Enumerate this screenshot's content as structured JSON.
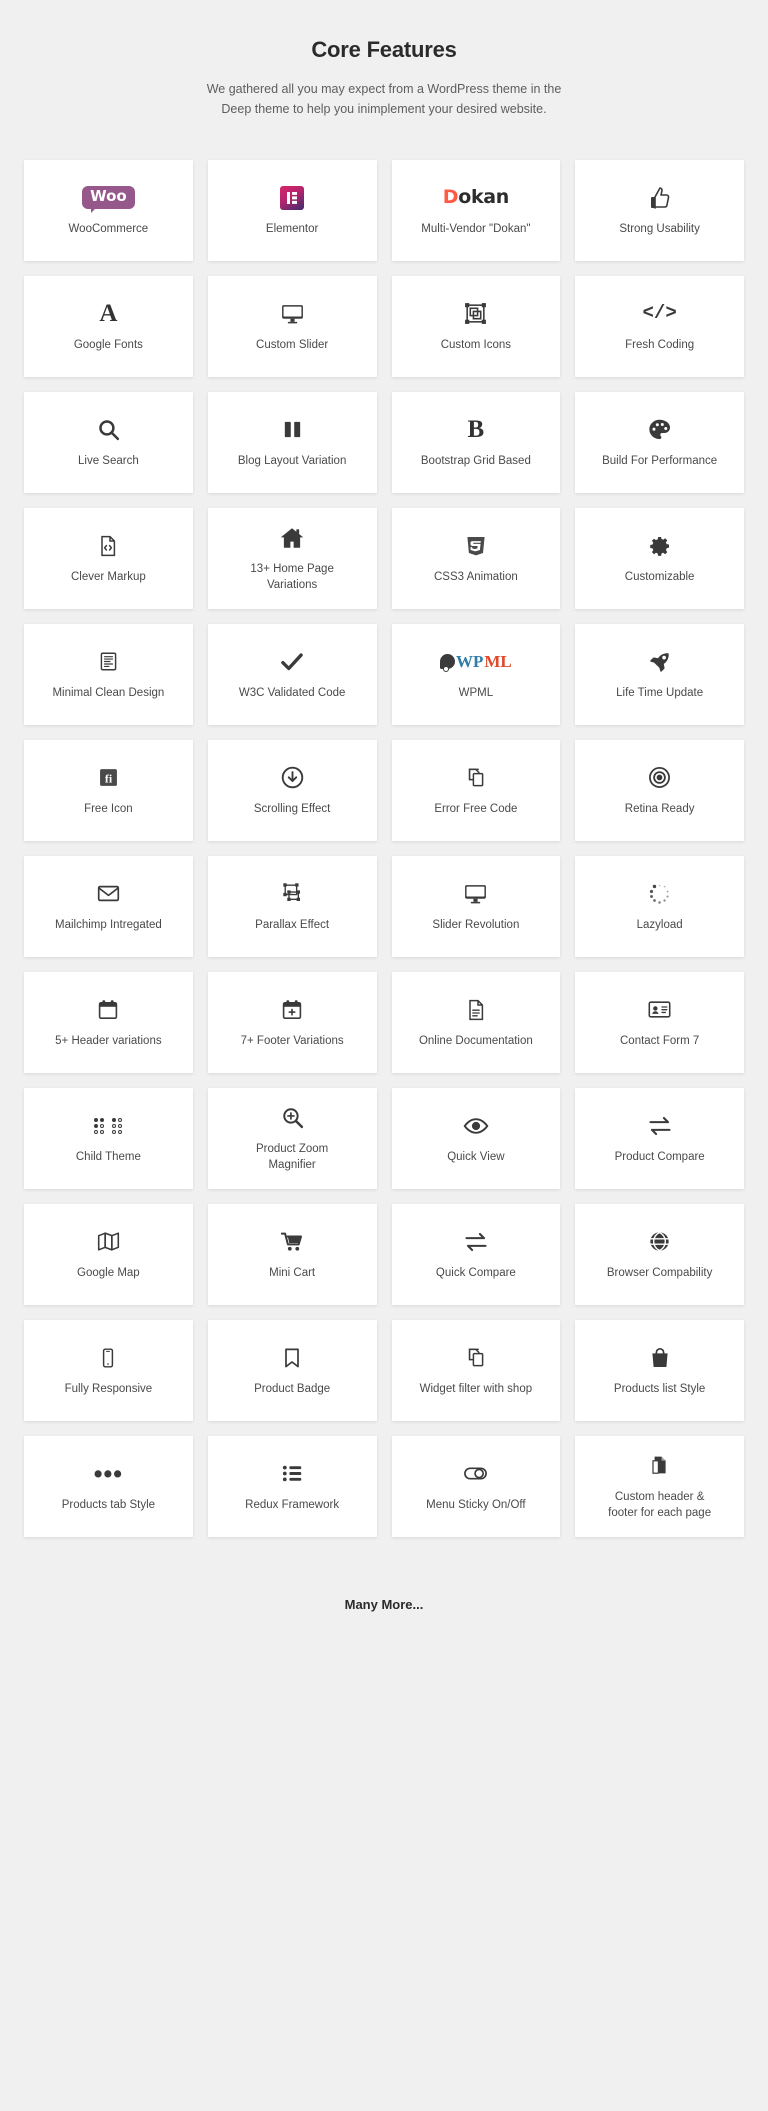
{
  "header": {
    "title": "Core Features",
    "subtitle": "We gathered all you may expect from a WordPress theme in the Deep theme to help you inimplement your desired website."
  },
  "brand_colors": {
    "woo_purple": "#96588a",
    "elementor_pink": "#d6266a",
    "elementor_indigo": "#3d2e6e",
    "dokan_orange": "#ff5a43",
    "wpml_blue": "#2f7da8",
    "wpml_red": "#e0482c",
    "card_bg": "#ffffff",
    "page_bg": "#f0f0f0",
    "icon_gray": "#3a3a3a",
    "label_gray": "#4a4a4a"
  },
  "features": [
    {
      "label": "WooCommerce",
      "icon": "woo-logo"
    },
    {
      "label": "Elementor",
      "icon": "elementor-logo"
    },
    {
      "label": "Multi-Vendor \"Dokan\"",
      "icon": "dokan-logo"
    },
    {
      "label": "Strong Usability",
      "icon": "thumbs-up-icon"
    },
    {
      "label": "Google Fonts",
      "icon": "letter-a-icon"
    },
    {
      "label": "Custom Slider",
      "icon": "monitor-icon"
    },
    {
      "label": "Custom Icons",
      "icon": "custom-icons-icon"
    },
    {
      "label": "Fresh Coding",
      "icon": "code-brackets-icon"
    },
    {
      "label": "Live Search",
      "icon": "magnifier-icon"
    },
    {
      "label": "Blog Layout Variation",
      "icon": "two-columns-icon"
    },
    {
      "label": "Bootstrap Grid Based",
      "icon": "letter-b-icon"
    },
    {
      "label": "Build For Performance",
      "icon": "palette-icon"
    },
    {
      "label": "Clever Markup",
      "icon": "file-code-icon"
    },
    {
      "label": "13+ Home Page Variations",
      "icon": "home-icon"
    },
    {
      "label": "CSS3 Animation",
      "icon": "css3-shield-icon"
    },
    {
      "label": "Customizable",
      "icon": "gear-icon"
    },
    {
      "label": "Minimal Clean Design",
      "icon": "clipboard-icon"
    },
    {
      "label": "W3C Validated Code",
      "icon": "check-icon"
    },
    {
      "label": "WPML",
      "icon": "wpml-logo"
    },
    {
      "label": "Life Time Update",
      "icon": "rocket-icon"
    },
    {
      "label": "Free Icon",
      "icon": "font-awesome-icon"
    },
    {
      "label": "Scrolling Effect",
      "icon": "arrow-down-circle-icon"
    },
    {
      "label": "Error Free Code",
      "icon": "copy-icon"
    },
    {
      "label": "Retina Ready",
      "icon": "target-icon"
    },
    {
      "label": "Mailchimp Intregated",
      "icon": "envelope-icon"
    },
    {
      "label": "Parallax Effect",
      "icon": "parallax-icon"
    },
    {
      "label": "Slider Revolution",
      "icon": "monitor-icon"
    },
    {
      "label": "Lazyload",
      "icon": "spinner-icon"
    },
    {
      "label": "5+ Header variations",
      "icon": "calendar-icon"
    },
    {
      "label": "7+ Footer Variations",
      "icon": "calendar-plus-icon"
    },
    {
      "label": "Online Documentation",
      "icon": "document-icon"
    },
    {
      "label": "Contact Form 7",
      "icon": "id-card-icon"
    },
    {
      "label": "Child Theme",
      "icon": "dot-matrix-icon"
    },
    {
      "label": "Product Zoom Magnifier",
      "icon": "magnifier-plus-icon"
    },
    {
      "label": "Quick View",
      "icon": "eye-icon"
    },
    {
      "label": "Product Compare",
      "icon": "exchange-arrows-icon"
    },
    {
      "label": "Google Map",
      "icon": "map-icon"
    },
    {
      "label": "Mini Cart",
      "icon": "cart-icon"
    },
    {
      "label": "Quick Compare",
      "icon": "exchange-arrows-icon"
    },
    {
      "label": "Browser Compability",
      "icon": "globe-icon"
    },
    {
      "label": "Fully Responsive",
      "icon": "mobile-icon"
    },
    {
      "label": "Product Badge",
      "icon": "bookmark-icon"
    },
    {
      "label": "Widget filter with shop",
      "icon": "copy-icon"
    },
    {
      "label": "Products list Style",
      "icon": "bag-icon"
    },
    {
      "label": "Products tab Style",
      "icon": "ellipsis-icon"
    },
    {
      "label": "Redux Framework",
      "icon": "list-ul-icon"
    },
    {
      "label": "Menu Sticky On/Off",
      "icon": "toggle-icon"
    },
    {
      "label": "Custom header & footer for each page",
      "icon": "pages-icon"
    }
  ],
  "footer": {
    "text": "Many More..."
  }
}
